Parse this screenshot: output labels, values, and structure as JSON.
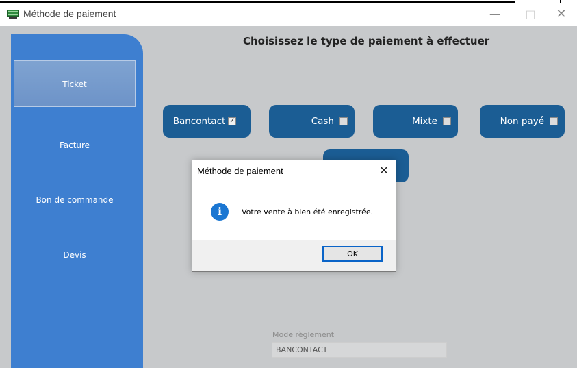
{
  "window": {
    "title": "Méthode de paiement",
    "minimize_glyph": "—",
    "maximize_glyph": "□",
    "close_glyph": "✕"
  },
  "sidebar": {
    "items": [
      {
        "label": "Ticket",
        "active": true
      },
      {
        "label": "Facture"
      },
      {
        "label": "Bon de commande"
      },
      {
        "label": "Devis"
      }
    ]
  },
  "main": {
    "heading": "Choisissez le type de paiement à effectuer",
    "payment_options": [
      {
        "label": "Bancontact",
        "checked": true
      },
      {
        "label": "Cash",
        "checked": false
      },
      {
        "label": "Mixte",
        "checked": false
      },
      {
        "label": "Non payé",
        "checked": false
      }
    ],
    "checked_glyph": "✓",
    "mode_reglement": {
      "label": "Mode règlement",
      "value": "BANCONTACT"
    }
  },
  "dialog": {
    "title": "Méthode de paiement",
    "close_glyph": "✕",
    "info_glyph": "i",
    "message": "Votre vente à bien été enregistrée.",
    "ok_label": "OK"
  },
  "colors": {
    "sidebar": "#3e7fd0",
    "payment_button": "#1b5d94",
    "background": "#c7c9cb",
    "info_icon": "#1a76d2",
    "ok_border": "#0a64c8"
  }
}
